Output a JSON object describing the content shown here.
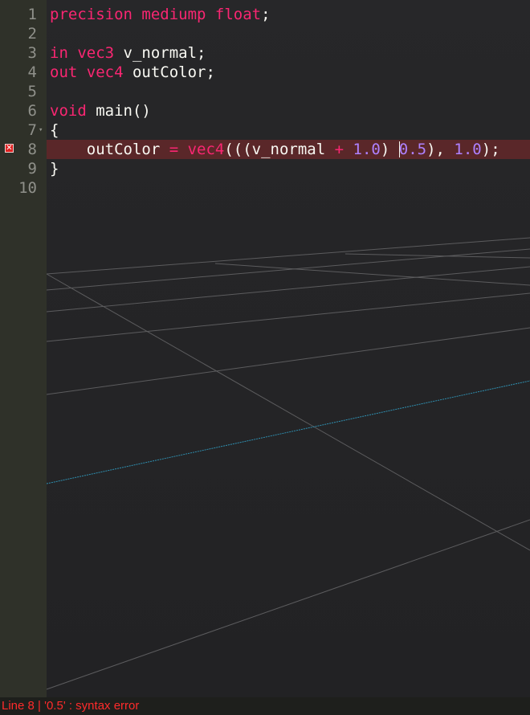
{
  "editor": {
    "line_numbers": [
      "1",
      "2",
      "3",
      "4",
      "5",
      "6",
      "7",
      "8",
      "9",
      "10"
    ],
    "fold_marker": "▾",
    "error_marker": "✕",
    "lines": {
      "l1": {
        "t1": "precision mediump float",
        "t2": ";"
      },
      "l3": {
        "t1": "in vec3",
        "t2": " v_normal;"
      },
      "l4": {
        "t1": "out vec4",
        "t2": " outColor;"
      },
      "l6": {
        "t1": "void",
        "t2": " main()"
      },
      "l7": {
        "t1": "{"
      },
      "l8": {
        "indent": "    ",
        "t1": "outColor",
        "t2": " = vec4",
        "t3": "(((v_normal ",
        "t4": "+",
        "t5": " ",
        "t6": "1.0",
        "t7": ") ",
        "t8": "0.5",
        "t9": "), ",
        "t10": "1.0",
        "t11": ");"
      },
      "l9": {
        "t1": "}"
      }
    }
  },
  "status": {
    "text": "Line 8 | '0.5' : syntax error"
  },
  "colors": {
    "keyword": "#f92672",
    "number": "#ae81ff",
    "text": "#f8f8f2",
    "gutter": "#2f3129",
    "error_line": "#5a2729",
    "status_error": "#ff2b2b",
    "grid_accent": "#2f8fb0"
  }
}
